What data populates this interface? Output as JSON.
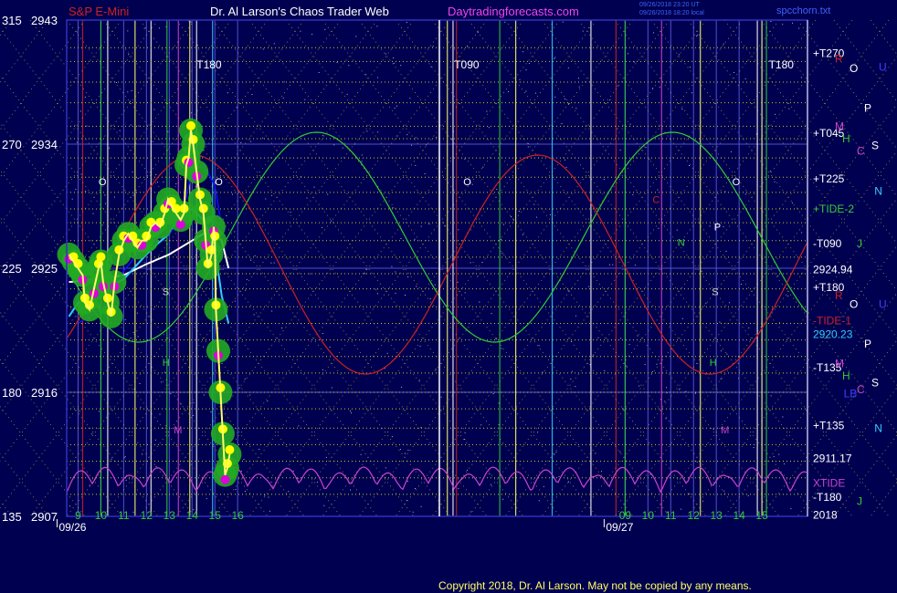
{
  "header": {
    "symbol": "S&P E-Mini",
    "author": "Dr. Al Larson's Chaos Trader Web",
    "site": "Daytradingforecasts.com",
    "stamp1": "09/26/2018 23:20 UT",
    "stamp2": "09/26/2018 18:20 local",
    "file": "spcchorn.txt"
  },
  "footer": {
    "copyright": "Copyright 2018, Dr. Al Larson. May not be copied by any means."
  },
  "colors": {
    "background": "#000050",
    "panel_border": "#3030c0",
    "price_line": "#ffff66",
    "white_ma": "#ffffff",
    "cyan_ma": "#33ccff",
    "blue_ma": "#1010ff",
    "green_halo": "#22aa22",
    "yellow_dots": "#ffff00",
    "magenta_dots": "#dd00dd",
    "magenta_osc": "#cc44cc",
    "green_tide": "#33cc33",
    "red_tide": "#cc2222",
    "grid_dotted": "#c8c820",
    "axis_text": "#ffffff"
  },
  "chart_data": {
    "type": "line",
    "title": "S&P E-Mini",
    "y_axis_left": [
      {
        "angle": "315",
        "price": "2943"
      },
      {
        "angle": "270",
        "price": "2934"
      },
      {
        "angle": "225",
        "price": "2925"
      },
      {
        "angle": "180",
        "price": "2916"
      },
      {
        "angle": "135",
        "price": "2907"
      }
    ],
    "ylim": [
      2907,
      2943
    ],
    "x_ticks": [
      {
        "label": "9",
        "t": 9
      },
      {
        "label": "10",
        "t": 10
      },
      {
        "label": "11",
        "t": 11
      },
      {
        "label": "12",
        "t": 12
      },
      {
        "label": "13",
        "t": 13
      },
      {
        "label": "14",
        "t": 14
      },
      {
        "label": "15",
        "t": 15
      },
      {
        "label": "16",
        "t": 16
      },
      {
        "label": "09",
        "t": 33
      },
      {
        "label": "10",
        "t": 34
      },
      {
        "label": "11",
        "t": 35
      },
      {
        "label": "12",
        "t": 36
      },
      {
        "label": "13",
        "t": 37
      },
      {
        "label": "14",
        "t": 38
      },
      {
        "label": "15",
        "t": 39
      }
    ],
    "x_range": [
      8.5,
      41
    ],
    "date_labels": [
      {
        "label": "09/26",
        "t": 9
      },
      {
        "label": "09/27",
        "t": 33
      }
    ],
    "day_break": 24.85,
    "price_series": {
      "name": "price",
      "points": [
        [
          8.6,
          2926
        ],
        [
          8.8,
          2925.5
        ],
        [
          9.0,
          2925
        ],
        [
          9.2,
          2924.5
        ],
        [
          9.3,
          2922.5
        ],
        [
          9.5,
          2922
        ],
        [
          9.7,
          2923.5
        ],
        [
          9.9,
          2925
        ],
        [
          10.0,
          2925.5
        ],
        [
          10.1,
          2924
        ],
        [
          10.3,
          2922.5
        ],
        [
          10.45,
          2921.5
        ],
        [
          10.6,
          2924
        ],
        [
          10.8,
          2926
        ],
        [
          11.0,
          2927
        ],
        [
          11.2,
          2927.5
        ],
        [
          11.4,
          2927
        ],
        [
          11.6,
          2926.5
        ],
        [
          11.8,
          2927
        ],
        [
          12.0,
          2927
        ],
        [
          12.2,
          2928
        ],
        [
          12.4,
          2928.3
        ],
        [
          12.6,
          2928
        ],
        [
          12.8,
          2929
        ],
        [
          12.95,
          2930
        ],
        [
          13.1,
          2929.5
        ],
        [
          13.3,
          2929
        ],
        [
          13.5,
          2928.5
        ],
        [
          13.65,
          2929
        ],
        [
          13.75,
          2932.5
        ],
        [
          13.85,
          2933
        ],
        [
          13.95,
          2935
        ],
        [
          14.05,
          2934
        ],
        [
          14.2,
          2932
        ],
        [
          14.35,
          2930
        ],
        [
          14.5,
          2929
        ],
        [
          14.6,
          2927
        ],
        [
          14.7,
          2925
        ],
        [
          14.85,
          2926
        ],
        [
          14.95,
          2928
        ],
        [
          15.0,
          2927
        ],
        [
          15.05,
          2922
        ],
        [
          15.15,
          2919
        ],
        [
          15.25,
          2916
        ],
        [
          15.35,
          2913
        ],
        [
          15.45,
          2910
        ],
        [
          15.55,
          2910.5
        ],
        [
          15.65,
          2911.5
        ]
      ]
    },
    "ma_series": [
      {
        "name": "white",
        "points": [
          [
            8.6,
            2924
          ],
          [
            10,
            2924.2
          ],
          [
            11,
            2924.5
          ],
          [
            12,
            2925.3
          ],
          [
            13,
            2926
          ],
          [
            14,
            2927
          ],
          [
            14.5,
            2927.5
          ],
          [
            15,
            2927.5
          ],
          [
            15.3,
            2927
          ],
          [
            15.6,
            2925
          ]
        ]
      },
      {
        "name": "cyan",
        "points": [
          [
            8.6,
            2921.5
          ],
          [
            9,
            2922.5
          ],
          [
            10,
            2923.3
          ],
          [
            11,
            2924.2
          ],
          [
            12,
            2926
          ],
          [
            12.5,
            2926.8
          ],
          [
            13,
            2927.5
          ],
          [
            13.5,
            2929
          ],
          [
            14,
            2929.3
          ],
          [
            14.5,
            2928.5
          ],
          [
            15,
            2926.5
          ],
          [
            15.3,
            2923
          ],
          [
            15.6,
            2921
          ]
        ]
      },
      {
        "name": "blue",
        "points": [
          [
            9,
            2921
          ],
          [
            10,
            2922
          ],
          [
            11,
            2924.8
          ],
          [
            12,
            2926.8
          ],
          [
            13,
            2927.5
          ],
          [
            13.5,
            2928.5
          ],
          [
            14,
            2932
          ],
          [
            14.5,
            2932.5
          ],
          [
            15,
            2931
          ],
          [
            15.3,
            2928
          ]
        ]
      }
    ],
    "right_axis_labels": [
      {
        "text": "+T270",
        "value": 2940.6,
        "color": "#ffffff"
      },
      {
        "text": "+T045",
        "value": 2934.8,
        "color": "#ffffff"
      },
      {
        "text": "+T225",
        "value": 2931.5,
        "color": "#ffffff"
      },
      {
        "text": "+TIDE-2",
        "value": 2929.3,
        "color": "#33cc33"
      },
      {
        "text": "-T090",
        "value": 2926.8,
        "color": "#ffffff"
      },
      {
        "text": "2924.94",
        "value": 2924.9,
        "color": "#ffffff"
      },
      {
        "text": "+T180",
        "value": 2923.6,
        "color": "#ffffff"
      },
      {
        "text": "-TIDE-1",
        "value": 2921.2,
        "color": "#cc2222"
      },
      {
        "text": "2920.23",
        "value": 2920.2,
        "color": "#33ccff"
      },
      {
        "text": "-T135",
        "value": 2917.8,
        "color": "#ffffff"
      },
      {
        "text": "+T135",
        "value": 2913.6,
        "color": "#ffffff"
      },
      {
        "text": "2911.17",
        "value": 2911.2,
        "color": "#ffffff"
      },
      {
        "text": "XTIDE",
        "value": 2909.4,
        "color": "#cc44cc"
      },
      {
        "text": "-T180",
        "value": 2908.4,
        "color": "#ffffff"
      },
      {
        "text": "2018",
        "value": 2907.1,
        "color": "#ffffff"
      }
    ],
    "planet_letters": [
      {
        "text": "R",
        "col": 0,
        "value": 2940.2,
        "color": "#cc2222"
      },
      {
        "text": "O",
        "col": 1,
        "value": 2939.5,
        "color": "#ffffff"
      },
      {
        "text": "U",
        "col": 3,
        "value": 2939.6,
        "color": "#4040ff"
      },
      {
        "text": "P",
        "col": 2,
        "value": 2936.6,
        "color": "#ffffff"
      },
      {
        "text": "M",
        "col": 0,
        "value": 2935.3,
        "color": "#cc44cc"
      },
      {
        "text": "H",
        "col": 0.5,
        "value": 2934.4,
        "color": "#33cc33"
      },
      {
        "text": "S",
        "col": 2.5,
        "value": 2933.9,
        "color": "#ffffff"
      },
      {
        "text": "C",
        "col": 1.5,
        "value": 2933.5,
        "color": "#cc44cc"
      },
      {
        "text": "N",
        "col": 2.7,
        "value": 2930.6,
        "color": "#33ccff"
      },
      {
        "text": "J",
        "col": 1.5,
        "value": 2926.8,
        "color": "#33cc33"
      },
      {
        "text": "R",
        "col": 0,
        "value": 2923.0,
        "color": "#cc2222"
      },
      {
        "text": "O",
        "col": 1,
        "value": 2922.4,
        "color": "#ffffff"
      },
      {
        "text": "U",
        "col": 3,
        "value": 2922.4,
        "color": "#4040ff"
      },
      {
        "text": "P",
        "col": 2,
        "value": 2919.5,
        "color": "#ffffff"
      },
      {
        "text": "M",
        "col": 0,
        "value": 2918.1,
        "color": "#cc44cc"
      },
      {
        "text": "H",
        "col": 0.5,
        "value": 2917.2,
        "color": "#33cc33"
      },
      {
        "text": "S",
        "col": 2.5,
        "value": 2916.7,
        "color": "#ffffff"
      },
      {
        "text": "LB",
        "col": 0.6,
        "value": 2915.9,
        "color": "#4040ff"
      },
      {
        "text": "C",
        "col": 1.5,
        "value": 2916.2,
        "color": "#cc44cc"
      },
      {
        "text": "N",
        "col": 2.7,
        "value": 2913.4,
        "color": "#33ccff"
      },
      {
        "text": "J",
        "col": 1.5,
        "value": 2908.1,
        "color": "#33cc33"
      }
    ],
    "vline_labels": [
      {
        "text": "T180",
        "t": 14.2,
        "color": "#ffffff"
      },
      {
        "text": "T090",
        "t": 25.5,
        "color": "#ffffff"
      },
      {
        "text": "T180",
        "t": 39.3,
        "color": "#ffffff"
      }
    ],
    "in_chart_letters": [
      {
        "text": "O",
        "t": 9.9,
        "value": 2931.3,
        "color": "#ffffff"
      },
      {
        "text": "O",
        "t": 15.0,
        "value": 2931.3,
        "color": "#ffffff"
      },
      {
        "text": "O",
        "t": 25.9,
        "value": 2931.3,
        "color": "#ffffff"
      },
      {
        "text": "O",
        "t": 37.7,
        "value": 2931.3,
        "color": "#ffffff"
      },
      {
        "text": "S",
        "t": 12.7,
        "value": 2923.3,
        "color": "#cccccc"
      },
      {
        "text": "S",
        "t": 36.8,
        "value": 2923.3,
        "color": "#cccccc"
      },
      {
        "text": "H",
        "t": 12.7,
        "value": 2918.2,
        "color": "#33cc33"
      },
      {
        "text": "H",
        "t": 36.7,
        "value": 2918.2,
        "color": "#33cc33"
      },
      {
        "text": "M",
        "t": 13.2,
        "value": 2913.3,
        "color": "#cc44cc"
      },
      {
        "text": "M",
        "t": 37.2,
        "value": 2913.3,
        "color": "#cc44cc"
      },
      {
        "text": "N",
        "t": 35.3,
        "value": 2926.9,
        "color": "#33cc33"
      },
      {
        "text": "P",
        "t": 36.9,
        "value": 2928.0,
        "color": "#ffffff"
      },
      {
        "text": "C",
        "t": 34.2,
        "value": 2930.0,
        "color": "#cc2222"
      }
    ],
    "grid": true,
    "legend": "none"
  }
}
